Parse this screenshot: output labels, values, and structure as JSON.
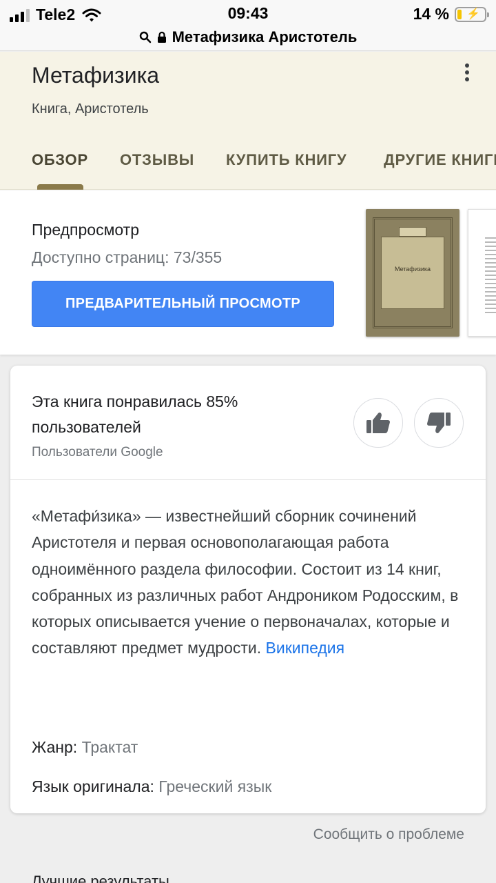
{
  "status_bar": {
    "carrier": "Tele2",
    "time": "09:43",
    "battery_percent": "14 %",
    "signal_bars": 3,
    "battery_level": 0.14,
    "icons": [
      "signal-icon",
      "wifi-icon",
      "battery-charging-icon"
    ]
  },
  "url_bar": {
    "text": "Метафизика Аристотель",
    "icons": [
      "search-icon",
      "lock-icon"
    ]
  },
  "header": {
    "title": "Метафизика",
    "subtitle": "Книга, Аристотель",
    "tabs": [
      {
        "label": "ОБЗОР",
        "active": true
      },
      {
        "label": "ОТЗЫВЫ",
        "active": false
      },
      {
        "label": "КУПИТЬ КНИГУ",
        "active": false
      },
      {
        "label": "ДРУГИЕ КНИГИ",
        "active": false
      }
    ]
  },
  "preview": {
    "title": "Предпросмотр",
    "pages": "Доступно страниц: 73/355",
    "button": "ПРЕДВАРИТЕЛЬНЫЙ ПРОСМОТР",
    "cover_title": "Метафизика"
  },
  "rating": {
    "text": "Эта книга понравилась 85% пользователей",
    "source": "Пользователи Google",
    "percent": 85
  },
  "description": {
    "text": "«Метафи́зика» — известнейший сборник сочинений Аристотеля и первая основополагающая работа одноимённого раздела философии. Состоит из 14 книг, собранных из различных работ Андроником Родосским, в которых описывается учение о первоначалах, которые и составляют предмет мудрости.",
    "link": "Википедия"
  },
  "facts": {
    "genre_label": "Жанр:",
    "genre_value": "Трактат",
    "language_label": "Язык оригинала:",
    "language_value": "Греческий язык"
  },
  "footer": {
    "report": "Сообщить о проблеме",
    "next_section": "Лучшие результаты"
  },
  "colors": {
    "header_bg": "#f6f3e6",
    "button_blue": "#4285f4",
    "link_blue": "#1a73e8",
    "tab_indicator": "#8a7a4a"
  }
}
